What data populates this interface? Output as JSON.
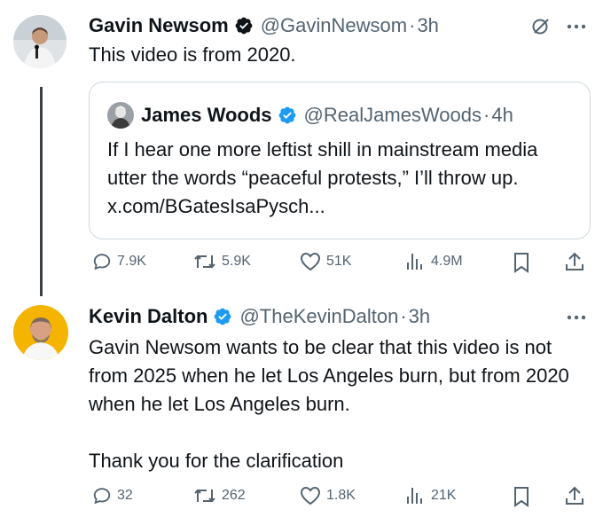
{
  "tweet1": {
    "name": "Gavin Newsom",
    "handle": "@GavinNewsom",
    "separator": "·",
    "time": "3h",
    "text": "This video is from 2020.",
    "quote": {
      "name": "James Woods",
      "handle": "@RealJamesWoods",
      "separator": "·",
      "time": "4h",
      "text": "If I hear one more leftist shill in mainstream media utter the words “peaceful protests,” I’ll throw up.  x.com/BGatesIsaPysch..."
    },
    "actions": {
      "replies": "7.9K",
      "reposts": "5.9K",
      "likes": "51K",
      "views": "4.9M"
    }
  },
  "tweet2": {
    "name": "Kevin Dalton",
    "handle": "@TheKevinDalton",
    "separator": "·",
    "time": "3h",
    "text_line1": "Gavin Newsom wants to be clear that this video is not from 2025 when he let Los Angeles burn, but from 2020 when he let Los Angeles burn.",
    "text_line2": "Thank you for the clarification",
    "actions": {
      "replies": "32",
      "reposts": "262",
      "likes": "1.8K",
      "views": "21K"
    }
  },
  "colors": {
    "verified": "#1d9bf0",
    "text": "#0f1419",
    "secondary": "#536471",
    "border": "#cfd9de"
  },
  "icons": [
    "verified-badge-icon",
    "grok-icon",
    "more-icon",
    "reply-icon",
    "repost-icon",
    "like-icon",
    "views-icon",
    "bookmark-icon",
    "share-icon"
  ]
}
